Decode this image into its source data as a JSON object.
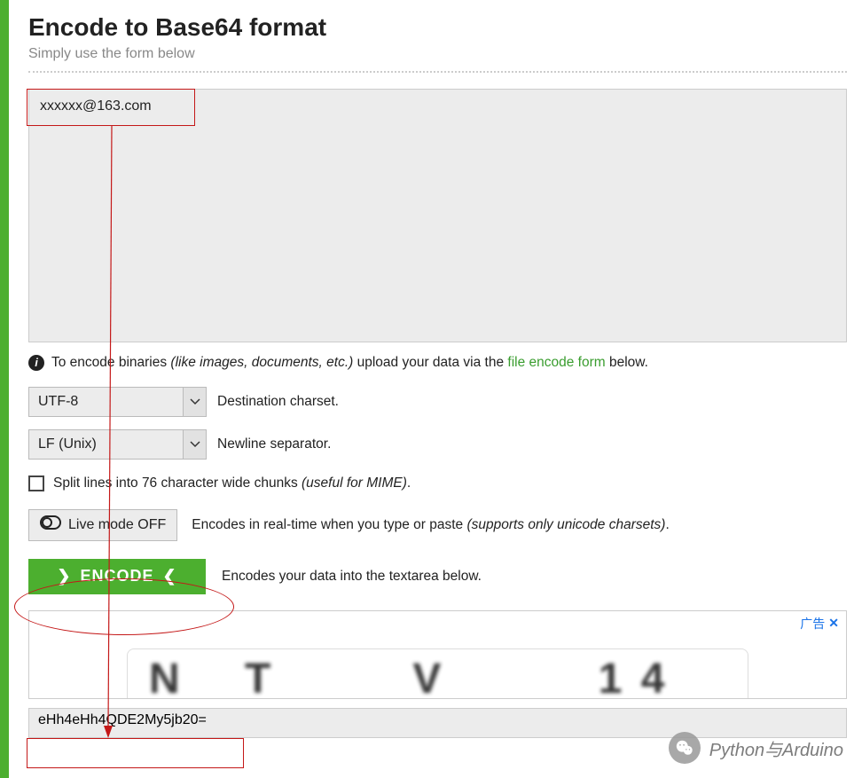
{
  "header": {
    "title": "Encode to Base64 format",
    "subtitle": "Simply use the form below"
  },
  "input": {
    "value": "xxxxxx@163.com"
  },
  "info": {
    "prefix": "To encode binaries ",
    "italic": "(like images, documents, etc.)",
    "mid": " upload your data via the ",
    "link": "file encode form",
    "suffix": " below."
  },
  "charset": {
    "value": "UTF-8",
    "label": "Destination charset."
  },
  "newline": {
    "value": "LF (Unix)",
    "label": "Newline separator."
  },
  "split": {
    "label_prefix": "Split lines into 76 character wide chunks ",
    "label_italic": "(useful for MIME)",
    "label_suffix": "."
  },
  "live": {
    "button": "Live mode OFF",
    "desc_prefix": "Encodes in real-time when you type or paste ",
    "desc_italic": "(supports only unicode charsets)",
    "desc_suffix": "."
  },
  "encode": {
    "button": "ENCODE",
    "desc": "Encodes your data into the textarea below."
  },
  "ad": {
    "label": "广告",
    "close": "✕"
  },
  "output": {
    "value": "eHh4eHh4QDE2My5jb20="
  },
  "watermark": {
    "text": "Python与Arduino"
  }
}
